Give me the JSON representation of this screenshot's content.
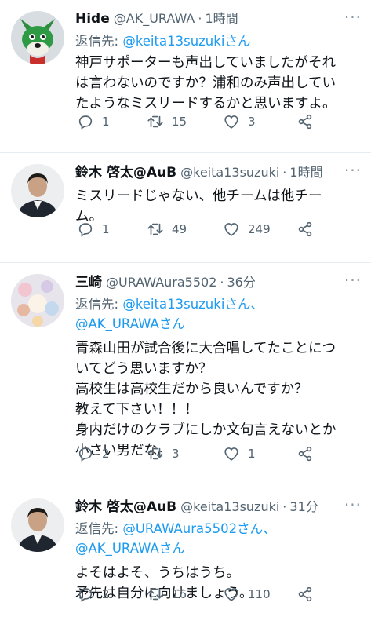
{
  "reply_prefix": "返信先: ",
  "tweets": [
    {
      "name": "Hide",
      "handle": "@AK_URAWA",
      "time": "1時間",
      "reply_to": [
        "@keita13suzukiさん"
      ],
      "lines": [
        "神戸サポーターも声出していましたがそれ",
        "は言わないのですか？浦和のみ声出してい",
        "たようなミスリードするかと思いますよ。"
      ],
      "replies": "1",
      "retweets": "15",
      "likes": "3"
    },
    {
      "name": "鈴木 啓太@AuB",
      "handle": "@keita13suzuki",
      "time": "1時間",
      "reply_to": [],
      "lines": [
        "ミスリードじゃない、他チームは他チー",
        "ム。"
      ],
      "replies": "1",
      "retweets": "49",
      "likes": "249"
    },
    {
      "name": "三崎",
      "handle": "@URAWAura5502",
      "time": "36分",
      "reply_to": [
        "@keita13suzukiさん、",
        "@AK_URAWAさん"
      ],
      "lines": [
        "青森山田が試合後に大合唱してたことにつ",
        "いてどう思いますか？",
        "高校生は高校生だから良いんですか？",
        "教えて下さい！！！",
        "身内だけのクラブにしか文句言えないとか",
        "小さい男だな。"
      ],
      "replies": "2",
      "retweets": "3",
      "likes": "1"
    },
    {
      "name": "鈴木 啓太@AuB",
      "handle": "@keita13suzuki",
      "time": "31分",
      "reply_to": [
        "@URAWAura5502さん、",
        "@AK_URAWAさん"
      ],
      "lines": [
        "よそはよそ、うちはうち。",
        "矛先は自分に向けましょう。"
      ],
      "replies": "2",
      "retweets": "16",
      "likes": "110"
    }
  ]
}
